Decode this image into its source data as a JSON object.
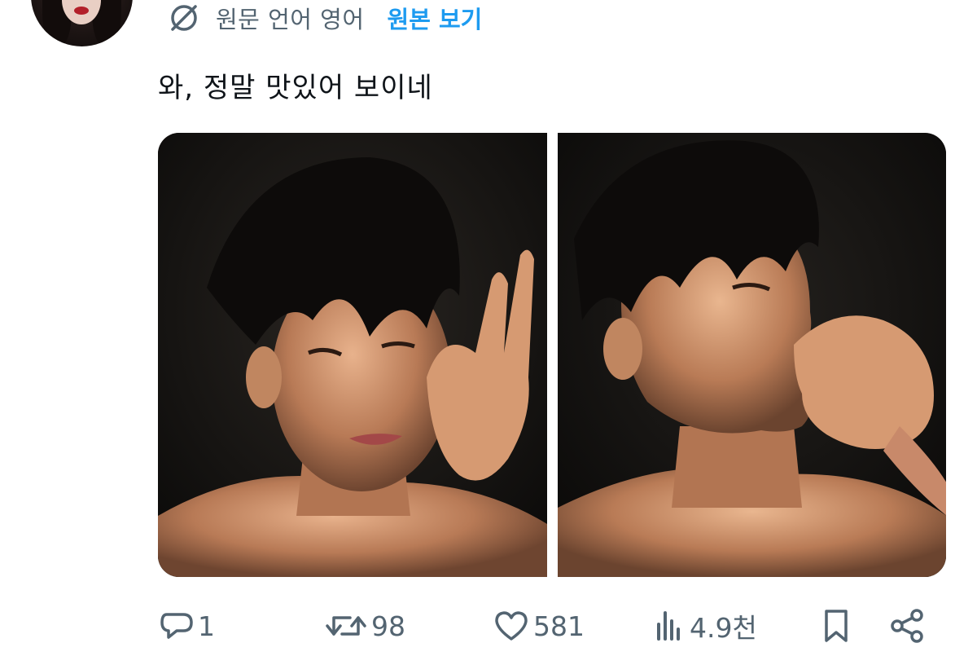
{
  "translation": {
    "icon": "globe-slash-icon",
    "label": "원문 언어 영어",
    "show_original": "원본 보기"
  },
  "tweet": {
    "text": "와, 정말 맛있어 보이네"
  },
  "media": {
    "photos": [
      {
        "alt": ""
      },
      {
        "alt": ""
      }
    ]
  },
  "actions": {
    "replies": "1",
    "retweets": "98",
    "likes": "581",
    "views": "4.9천"
  },
  "colors": {
    "text_primary": "#0f1419",
    "text_secondary": "#536471",
    "accent": "#1d9bf0"
  }
}
